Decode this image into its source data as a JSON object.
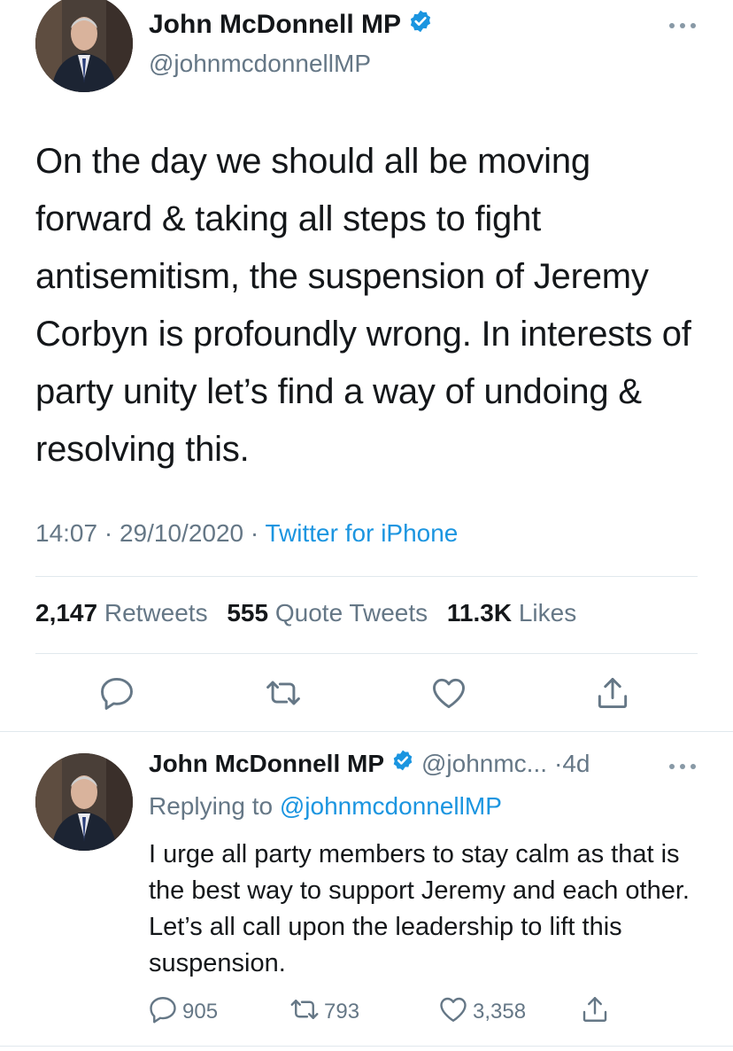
{
  "colors": {
    "accent": "#1b95e0",
    "text": "#14171a",
    "secondary": "#657786",
    "divider": "#e1e8ed"
  },
  "main_tweet": {
    "author": {
      "name": "John McDonnell MP",
      "handle": "@johnmcdonnellMP",
      "verified": true
    },
    "text": "On the day we should all be moving forward & taking all steps to fight antisemitism, the suspension of Jeremy Corbyn is profoundly wrong. In interests of party unity let’s find a way of undoing & resolving this.",
    "time": "14:07",
    "date": "29/10/2020",
    "separator": "·",
    "source": "Twitter for iPhone",
    "stats": {
      "retweets_count": "2,147",
      "retweets_label": "Retweets",
      "quotes_count": "555",
      "quotes_label": "Quote Tweets",
      "likes_count": "11.3K",
      "likes_label": "Likes"
    },
    "actions": [
      "reply-icon",
      "retweet-icon",
      "like-icon",
      "share-icon"
    ]
  },
  "reply_tweet": {
    "author": {
      "name": "John McDonnell MP",
      "handle": "@johnmc...",
      "verified": true
    },
    "age_separator": "·",
    "age": "4d",
    "replying_prefix": "Replying to",
    "replying_handle": "@johnmcdonnellMP",
    "text": "I urge all party members to stay calm as that is the best way to support Jeremy and each other. Let’s all call upon the leadership to lift this suspension.",
    "counts": {
      "replies": "905",
      "retweets": "793",
      "likes": "3,358"
    }
  }
}
